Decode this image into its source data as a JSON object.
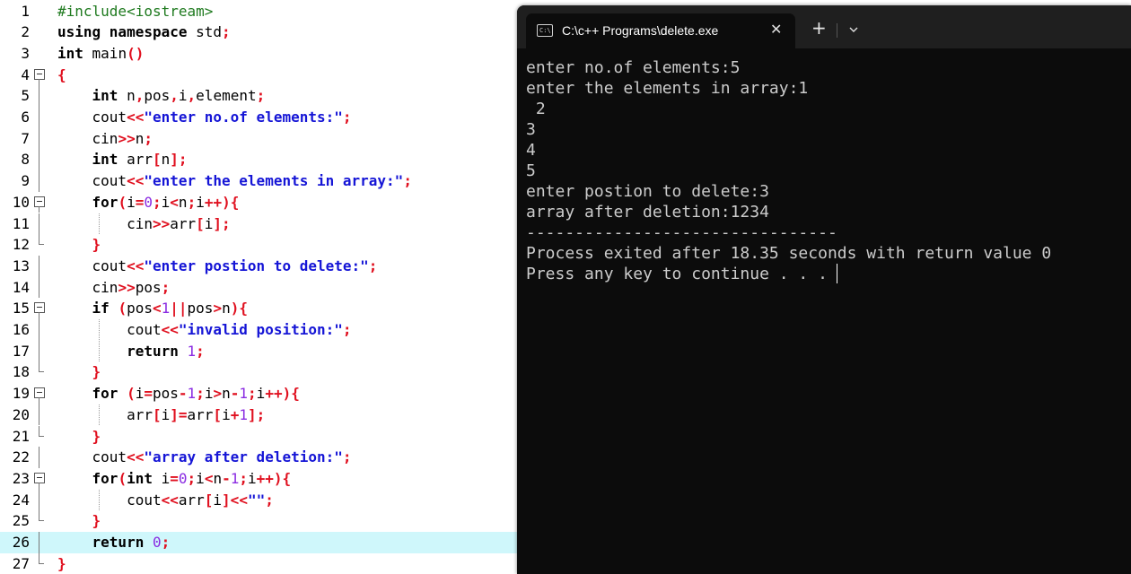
{
  "editor": {
    "line_numbers": [
      "1",
      "2",
      "3",
      "4",
      "5",
      "6",
      "7",
      "8",
      "9",
      "10",
      "11",
      "12",
      "13",
      "14",
      "15",
      "16",
      "17",
      "18",
      "19",
      "20",
      "21",
      "22",
      "23",
      "24",
      "25",
      "26",
      "27"
    ],
    "lines": [
      [
        {
          "t": "#include<iostream>",
          "c": "pp"
        }
      ],
      [
        {
          "t": "using namespace",
          "c": "kw"
        },
        {
          "t": " std",
          "c": ""
        },
        {
          "t": ";",
          "c": "op"
        }
      ],
      [
        {
          "t": "int",
          "c": "kw"
        },
        {
          "t": " main",
          "c": ""
        },
        {
          "t": "()",
          "c": "op"
        }
      ],
      [
        {
          "t": "{",
          "c": "op"
        }
      ],
      [
        {
          "t": "    ",
          "c": ""
        },
        {
          "t": "int",
          "c": "kw"
        },
        {
          "t": " n",
          "c": ""
        },
        {
          "t": ",",
          "c": "op"
        },
        {
          "t": "pos",
          "c": ""
        },
        {
          "t": ",",
          "c": "op"
        },
        {
          "t": "i",
          "c": ""
        },
        {
          "t": ",",
          "c": "op"
        },
        {
          "t": "element",
          "c": ""
        },
        {
          "t": ";",
          "c": "op"
        }
      ],
      [
        {
          "t": "    cout",
          "c": ""
        },
        {
          "t": "<<",
          "c": "op"
        },
        {
          "t": "\"enter no.of elements:\"",
          "c": "str"
        },
        {
          "t": ";",
          "c": "op"
        }
      ],
      [
        {
          "t": "    cin",
          "c": ""
        },
        {
          "t": ">>",
          "c": "op"
        },
        {
          "t": "n",
          "c": ""
        },
        {
          "t": ";",
          "c": "op"
        }
      ],
      [
        {
          "t": "    ",
          "c": ""
        },
        {
          "t": "int",
          "c": "kw"
        },
        {
          "t": " arr",
          "c": ""
        },
        {
          "t": "[",
          "c": "op"
        },
        {
          "t": "n",
          "c": ""
        },
        {
          "t": "];",
          "c": "op"
        }
      ],
      [
        {
          "t": "    cout",
          "c": ""
        },
        {
          "t": "<<",
          "c": "op"
        },
        {
          "t": "\"enter the elements in array:\"",
          "c": "str"
        },
        {
          "t": ";",
          "c": "op"
        }
      ],
      [
        {
          "t": "    ",
          "c": ""
        },
        {
          "t": "for",
          "c": "kw"
        },
        {
          "t": "(",
          "c": "op"
        },
        {
          "t": "i",
          "c": ""
        },
        {
          "t": "=",
          "c": "op"
        },
        {
          "t": "0",
          "c": "num"
        },
        {
          "t": ";",
          "c": "op"
        },
        {
          "t": "i",
          "c": ""
        },
        {
          "t": "<",
          "c": "op"
        },
        {
          "t": "n",
          "c": ""
        },
        {
          "t": ";",
          "c": "op"
        },
        {
          "t": "i",
          "c": ""
        },
        {
          "t": "++){",
          "c": "op"
        }
      ],
      [
        {
          "t": "        cin",
          "c": ""
        },
        {
          "t": ">>",
          "c": "op"
        },
        {
          "t": "arr",
          "c": ""
        },
        {
          "t": "[",
          "c": "op"
        },
        {
          "t": "i",
          "c": ""
        },
        {
          "t": "];",
          "c": "op"
        }
      ],
      [
        {
          "t": "    ",
          "c": ""
        },
        {
          "t": "}",
          "c": "op"
        }
      ],
      [
        {
          "t": "    cout",
          "c": ""
        },
        {
          "t": "<<",
          "c": "op"
        },
        {
          "t": "\"enter postion to delete:\"",
          "c": "str"
        },
        {
          "t": ";",
          "c": "op"
        }
      ],
      [
        {
          "t": "    cin",
          "c": ""
        },
        {
          "t": ">>",
          "c": "op"
        },
        {
          "t": "pos",
          "c": ""
        },
        {
          "t": ";",
          "c": "op"
        }
      ],
      [
        {
          "t": "    ",
          "c": ""
        },
        {
          "t": "if",
          "c": "kw"
        },
        {
          "t": " ",
          "c": ""
        },
        {
          "t": "(",
          "c": "op"
        },
        {
          "t": "pos",
          "c": ""
        },
        {
          "t": "<",
          "c": "op"
        },
        {
          "t": "1",
          "c": "num"
        },
        {
          "t": "||",
          "c": "op"
        },
        {
          "t": "pos",
          "c": ""
        },
        {
          "t": ">",
          "c": "op"
        },
        {
          "t": "n",
          "c": ""
        },
        {
          "t": "){",
          "c": "op"
        }
      ],
      [
        {
          "t": "        cout",
          "c": ""
        },
        {
          "t": "<<",
          "c": "op"
        },
        {
          "t": "\"invalid position:\"",
          "c": "str"
        },
        {
          "t": ";",
          "c": "op"
        }
      ],
      [
        {
          "t": "        ",
          "c": ""
        },
        {
          "t": "return",
          "c": "kw"
        },
        {
          "t": " ",
          "c": ""
        },
        {
          "t": "1",
          "c": "num"
        },
        {
          "t": ";",
          "c": "op"
        }
      ],
      [
        {
          "t": "    ",
          "c": ""
        },
        {
          "t": "}",
          "c": "op"
        }
      ],
      [
        {
          "t": "    ",
          "c": ""
        },
        {
          "t": "for",
          "c": "kw"
        },
        {
          "t": " ",
          "c": ""
        },
        {
          "t": "(",
          "c": "op"
        },
        {
          "t": "i",
          "c": ""
        },
        {
          "t": "=",
          "c": "op"
        },
        {
          "t": "pos",
          "c": ""
        },
        {
          "t": "-",
          "c": "op"
        },
        {
          "t": "1",
          "c": "num"
        },
        {
          "t": ";",
          "c": "op"
        },
        {
          "t": "i",
          "c": ""
        },
        {
          "t": ">",
          "c": "op"
        },
        {
          "t": "n",
          "c": ""
        },
        {
          "t": "-",
          "c": "op"
        },
        {
          "t": "1",
          "c": "num"
        },
        {
          "t": ";",
          "c": "op"
        },
        {
          "t": "i",
          "c": ""
        },
        {
          "t": "++){",
          "c": "op"
        }
      ],
      [
        {
          "t": "        arr",
          "c": ""
        },
        {
          "t": "[",
          "c": "op"
        },
        {
          "t": "i",
          "c": ""
        },
        {
          "t": "]=",
          "c": "op"
        },
        {
          "t": "arr",
          "c": ""
        },
        {
          "t": "[",
          "c": "op"
        },
        {
          "t": "i",
          "c": ""
        },
        {
          "t": "+",
          "c": "op"
        },
        {
          "t": "1",
          "c": "num"
        },
        {
          "t": "];",
          "c": "op"
        }
      ],
      [
        {
          "t": "    ",
          "c": ""
        },
        {
          "t": "}",
          "c": "op"
        }
      ],
      [
        {
          "t": "    cout",
          "c": ""
        },
        {
          "t": "<<",
          "c": "op"
        },
        {
          "t": "\"array after deletion:\"",
          "c": "str"
        },
        {
          "t": ";",
          "c": "op"
        }
      ],
      [
        {
          "t": "    ",
          "c": ""
        },
        {
          "t": "for",
          "c": "kw"
        },
        {
          "t": "(",
          "c": "op"
        },
        {
          "t": "int",
          "c": "kw"
        },
        {
          "t": " i",
          "c": ""
        },
        {
          "t": "=",
          "c": "op"
        },
        {
          "t": "0",
          "c": "num"
        },
        {
          "t": ";",
          "c": "op"
        },
        {
          "t": "i",
          "c": ""
        },
        {
          "t": "<",
          "c": "op"
        },
        {
          "t": "n",
          "c": ""
        },
        {
          "t": "-",
          "c": "op"
        },
        {
          "t": "1",
          "c": "num"
        },
        {
          "t": ";",
          "c": "op"
        },
        {
          "t": "i",
          "c": ""
        },
        {
          "t": "++){",
          "c": "op"
        }
      ],
      [
        {
          "t": "        cout",
          "c": ""
        },
        {
          "t": "<<",
          "c": "op"
        },
        {
          "t": "arr",
          "c": ""
        },
        {
          "t": "[",
          "c": "op"
        },
        {
          "t": "i",
          "c": ""
        },
        {
          "t": "]<<",
          "c": "op"
        },
        {
          "t": "\"\"",
          "c": "str"
        },
        {
          "t": ";",
          "c": "op"
        }
      ],
      [
        {
          "t": "    ",
          "c": ""
        },
        {
          "t": "}",
          "c": "op"
        }
      ],
      [
        {
          "t": "    ",
          "c": ""
        },
        {
          "t": "return",
          "c": "kw"
        },
        {
          "t": " ",
          "c": ""
        },
        {
          "t": "0",
          "c": "num"
        },
        {
          "t": ";",
          "c": "op"
        }
      ],
      [
        {
          "t": "}",
          "c": "op"
        }
      ]
    ],
    "highlighted_line": 26,
    "colors": {
      "highlight": "#cff7fb",
      "keyword": "#000000",
      "string": "#1515d6",
      "number": "#8a2be2",
      "operator": "#e0101f",
      "preprocessor": "#1f7a1f"
    }
  },
  "terminal": {
    "tab": {
      "icon": "cmd-icon",
      "icon_text": "C:\\",
      "title": "C:\\c++ Programs\\delete.exe",
      "close_icon": "✕"
    },
    "new_tab_icon": "+",
    "dropdown_icon": "chevron-down-icon",
    "output_lines": [
      "enter no.of elements:5",
      "enter the elements in array:1",
      " 2",
      "3",
      "4",
      "5",
      "enter postion to delete:3",
      "array after deletion:1234",
      "--------------------------------",
      "Process exited after 18.35 seconds with return value 0",
      "Press any key to continue . . ."
    ],
    "colors": {
      "background": "#0c0c0c",
      "titlebar": "#1f1f1f",
      "text": "#cccccc"
    }
  }
}
